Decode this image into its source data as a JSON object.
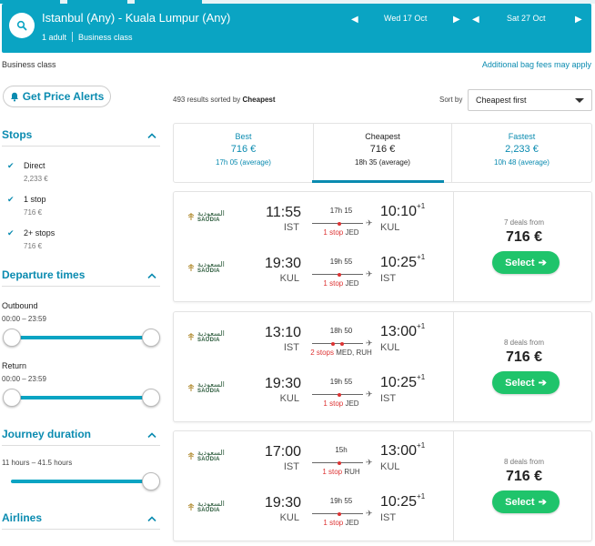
{
  "header": {
    "route": "Istanbul (Any) - Kuala Lumpur (Any)",
    "passengers": "1 adult",
    "cabin": "Business class",
    "outbound_date": "Wed 17 Oct",
    "return_date": "Sat 27 Oct"
  },
  "subheader": {
    "cabin_label": "Business class",
    "bag_fees_link": "Additional bag fees may apply"
  },
  "sidebar": {
    "price_alerts_label": "Get Price Alerts",
    "stops": {
      "title": "Stops",
      "options": [
        {
          "label": "Direct",
          "price": "2,233 €",
          "checked": true
        },
        {
          "label": "1 stop",
          "price": "716 €",
          "checked": true
        },
        {
          "label": "2+ stops",
          "price": "716 €",
          "checked": true
        }
      ]
    },
    "departure_times": {
      "title": "Departure times",
      "outbound_label": "Outbound",
      "outbound_range": "00:00 – 23:59",
      "return_label": "Return",
      "return_range": "00:00 – 23:59"
    },
    "journey_duration": {
      "title": "Journey duration",
      "range": "11 hours – 41.5 hours"
    },
    "airlines": {
      "title": "Airlines"
    }
  },
  "results": {
    "count": "493 results sorted by",
    "sorted_by": "Cheapest",
    "sort_label": "Sort by",
    "sort_value": "Cheapest first"
  },
  "summary": {
    "best": {
      "title": "Best",
      "price": "716 €",
      "duration": "17h 05 (average)"
    },
    "cheapest": {
      "title": "Cheapest",
      "price": "716 €",
      "duration": "18h 35 (average)"
    },
    "fastest": {
      "title": "Fastest",
      "price": "2,233 €",
      "duration": "10h 48 (average)"
    }
  },
  "flights": [
    {
      "deals": "7 deals from",
      "price": "716 €",
      "select_label": "Select",
      "legs": [
        {
          "airline": "SAUDIA",
          "airline_ar": "السعودية",
          "dep_time": "11:55",
          "dep_airport": "IST",
          "duration": "17h 15",
          "stops_count": "1 stop",
          "stops_via": "JED",
          "arr_time": "10:10",
          "arr_plus": "+1",
          "arr_airport": "KUL"
        },
        {
          "airline": "SAUDIA",
          "airline_ar": "السعودية",
          "dep_time": "19:30",
          "dep_airport": "KUL",
          "duration": "19h 55",
          "stops_count": "1 stop",
          "stops_via": "JED",
          "arr_time": "10:25",
          "arr_plus": "+1",
          "arr_airport": "IST"
        }
      ]
    },
    {
      "deals": "8 deals from",
      "price": "716 €",
      "select_label": "Select",
      "legs": [
        {
          "airline": "SAUDIA",
          "airline_ar": "السعودية",
          "dep_time": "13:10",
          "dep_airport": "IST",
          "duration": "18h 50",
          "stops_count": "2 stops",
          "stops_via": "MED, RUH",
          "arr_time": "13:00",
          "arr_plus": "+1",
          "arr_airport": "KUL"
        },
        {
          "airline": "SAUDIA",
          "airline_ar": "السعودية",
          "dep_time": "19:30",
          "dep_airport": "KUL",
          "duration": "19h 55",
          "stops_count": "1 stop",
          "stops_via": "JED",
          "arr_time": "10:25",
          "arr_plus": "+1",
          "arr_airport": "IST"
        }
      ]
    },
    {
      "deals": "8 deals from",
      "price": "716 €",
      "select_label": "Select",
      "legs": [
        {
          "airline": "SAUDIA",
          "airline_ar": "السعودية",
          "dep_time": "17:00",
          "dep_airport": "IST",
          "duration": "15h",
          "stops_count": "1 stop",
          "stops_via": "RUH",
          "arr_time": "13:00",
          "arr_plus": "+1",
          "arr_airport": "KUL"
        },
        {
          "airline": "SAUDIA",
          "airline_ar": "السعودية",
          "dep_time": "19:30",
          "dep_airport": "KUL",
          "duration": "19h 55",
          "stops_count": "1 stop",
          "stops_via": "JED",
          "arr_time": "10:25",
          "arr_plus": "+1",
          "arr_airport": "IST"
        }
      ]
    }
  ],
  "colors": {
    "brand": "#0aa4c3",
    "link": "#0a8bb0",
    "select_button": "#1fc46b",
    "stop_dot": "#d33333"
  }
}
